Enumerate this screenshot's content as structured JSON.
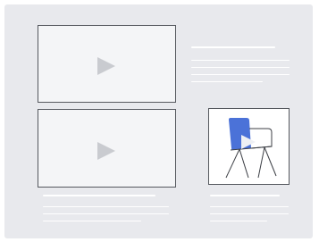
{
  "colors": {
    "panel_background": "#e8e9ed",
    "placeholder_line": "#ffffff",
    "card_background": "#f4f5f7",
    "card_border": "#55585e",
    "play_icon": "#c9cbd0",
    "chair_accent": "#4b72d8",
    "chair_outline": "#3c3f45"
  },
  "cards": [
    {
      "kind": "video",
      "icon": "play-icon"
    },
    {
      "kind": "video",
      "icon": "play-icon"
    }
  ],
  "product": {
    "icon": "chair-icon",
    "overlay_icon": "play-icon"
  }
}
